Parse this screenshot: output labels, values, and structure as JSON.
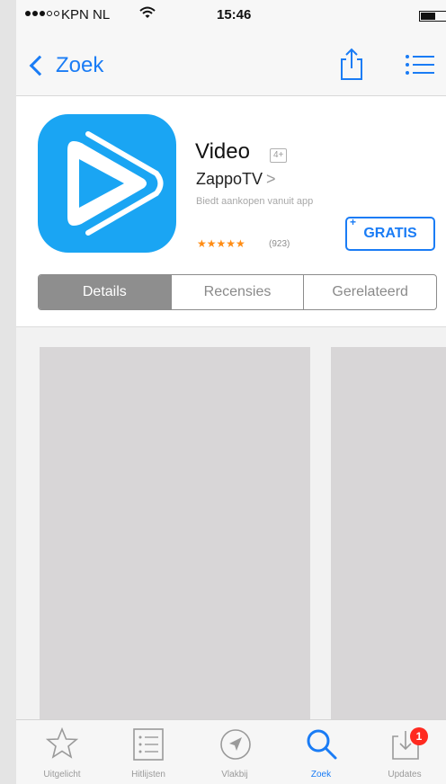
{
  "status_bar": {
    "carrier": "KPN NL",
    "time": "15:46"
  },
  "nav": {
    "back_label": "Zoek"
  },
  "app": {
    "title": "Video",
    "age_rating": "4+",
    "developer": "ZappoTV",
    "developer_chevron": ">",
    "iap_note": "Biedt aankopen vanuit app",
    "stars": "★★★★★",
    "rating_count": "(923)",
    "get_label": "GRATIS",
    "get_plus": "+"
  },
  "segments": {
    "details": "Details",
    "reviews": "Recensies",
    "related": "Gerelateerd",
    "active": "Details"
  },
  "tab_bar": {
    "featured": "Uitgelicht",
    "top_charts": "Hitlijsten",
    "near_me": "Vlakbij",
    "search": "Zoek",
    "updates": "Updates",
    "updates_badge": "1",
    "active": "Zoek"
  },
  "colors": {
    "accent": "#1a7cf5",
    "app_icon": "#1aa5f3",
    "stars": "#ff8c14",
    "badge": "#ff2a20",
    "segment_active": "#8e8e8e"
  }
}
